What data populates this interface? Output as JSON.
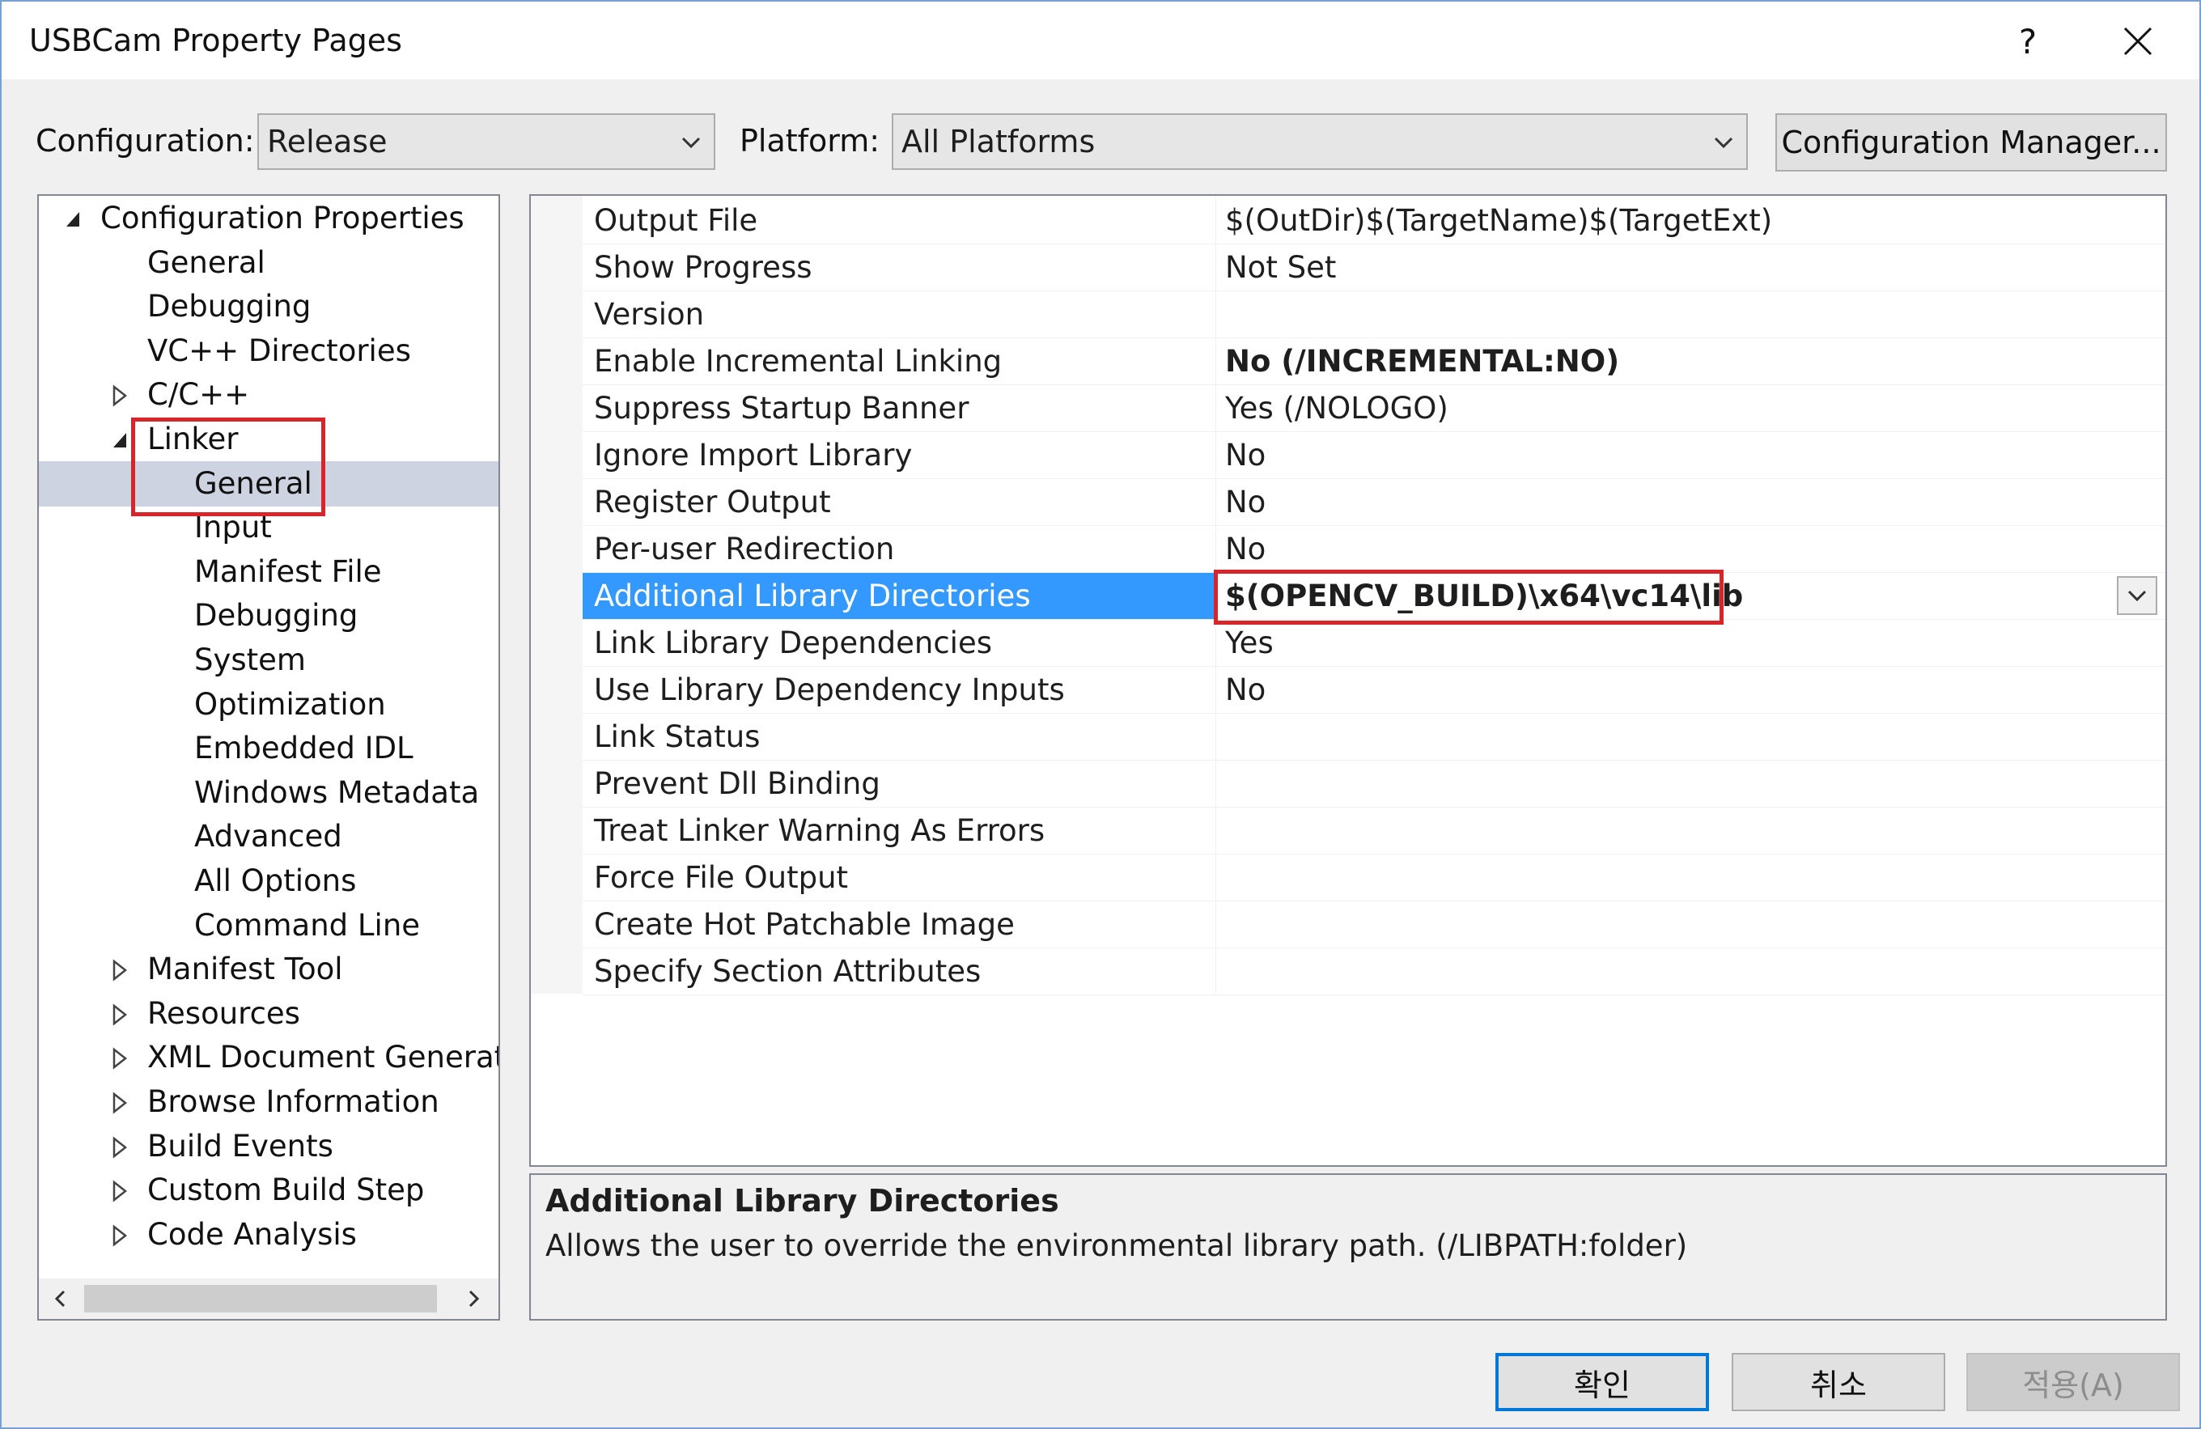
{
  "window": {
    "title": "USBCam Property Pages",
    "help_label": "?"
  },
  "toolbar": {
    "configuration_label": "Configuration:",
    "configuration_value": "Release",
    "platform_label": "Platform:",
    "platform_value": "All Platforms",
    "config_manager_label": "Configuration Manager..."
  },
  "tree": {
    "items": [
      {
        "label": "Configuration Properties",
        "expander": "expanded"
      },
      {
        "label": "General",
        "expander": "none"
      },
      {
        "label": "Debugging",
        "expander": "none"
      },
      {
        "label": "VC++ Directories",
        "expander": "none"
      },
      {
        "label": "C/C++",
        "expander": "collapsed"
      },
      {
        "label": "Linker",
        "expander": "expanded"
      },
      {
        "label": "General",
        "expander": "none",
        "selected": true
      },
      {
        "label": "Input",
        "expander": "none"
      },
      {
        "label": "Manifest File",
        "expander": "none"
      },
      {
        "label": "Debugging",
        "expander": "none"
      },
      {
        "label": "System",
        "expander": "none"
      },
      {
        "label": "Optimization",
        "expander": "none"
      },
      {
        "label": "Embedded IDL",
        "expander": "none"
      },
      {
        "label": "Windows Metadata",
        "expander": "none"
      },
      {
        "label": "Advanced",
        "expander": "none"
      },
      {
        "label": "All Options",
        "expander": "none"
      },
      {
        "label": "Command Line",
        "expander": "none"
      },
      {
        "label": "Manifest Tool",
        "expander": "collapsed"
      },
      {
        "label": "Resources",
        "expander": "collapsed"
      },
      {
        "label": "XML Document Generator",
        "expander": "collapsed"
      },
      {
        "label": "Browse Information",
        "expander": "collapsed"
      },
      {
        "label": "Build Events",
        "expander": "collapsed"
      },
      {
        "label": "Custom Build Step",
        "expander": "collapsed"
      },
      {
        "label": "Code Analysis",
        "expander": "collapsed"
      }
    ]
  },
  "properties": {
    "rows": [
      {
        "name": "Output File",
        "value": "$(OutDir)$(TargetName)$(TargetExt)"
      },
      {
        "name": "Show Progress",
        "value": "Not Set"
      },
      {
        "name": "Version",
        "value": ""
      },
      {
        "name": "Enable Incremental Linking",
        "value": "No (/INCREMENTAL:NO)",
        "bold": true
      },
      {
        "name": "Suppress Startup Banner",
        "value": "Yes (/NOLOGO)"
      },
      {
        "name": "Ignore Import Library",
        "value": "No"
      },
      {
        "name": "Register Output",
        "value": "No"
      },
      {
        "name": "Per-user Redirection",
        "value": "No"
      },
      {
        "name": "Additional Library Directories",
        "value": "$(OPENCV_BUILD)\\x64\\vc14\\lib",
        "bold": true,
        "selected": true
      },
      {
        "name": "Link Library Dependencies",
        "value": "Yes"
      },
      {
        "name": "Use Library Dependency Inputs",
        "value": "No"
      },
      {
        "name": "Link Status",
        "value": ""
      },
      {
        "name": "Prevent Dll Binding",
        "value": ""
      },
      {
        "name": "Treat Linker Warning As Errors",
        "value": ""
      },
      {
        "name": "Force File Output",
        "value": ""
      },
      {
        "name": "Create Hot Patchable Image",
        "value": ""
      },
      {
        "name": "Specify Section Attributes",
        "value": ""
      }
    ]
  },
  "description": {
    "title": "Additional Library Directories",
    "text": "Allows the user to override the environmental library path. (/LIBPATH:folder)"
  },
  "buttons": {
    "ok": "확인",
    "cancel": "취소",
    "apply": "적용(A)"
  },
  "colors": {
    "selection_blue": "#3399ff",
    "tree_selection": "#cdd3e0",
    "annotation_red": "#d6262b"
  }
}
